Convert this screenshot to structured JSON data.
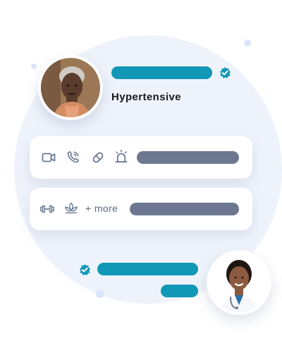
{
  "patient": {
    "condition_label": "Hypertensive",
    "verified": true,
    "avatar": "elderly-woman-avatar"
  },
  "communication_card": {
    "icons": [
      "video-call-icon",
      "phone-call-icon",
      "pill-icon",
      "alarm-icon"
    ]
  },
  "care_card": {
    "icons": [
      "dumbbell-icon",
      "lotus-icon"
    ],
    "more_label": "+ more"
  },
  "doctor": {
    "verified": true,
    "avatar": "doctor-avatar"
  },
  "colors": {
    "accent": "#1297b6",
    "placeholder_bar": "#6d7890",
    "background_circle": "#eef3fb"
  }
}
